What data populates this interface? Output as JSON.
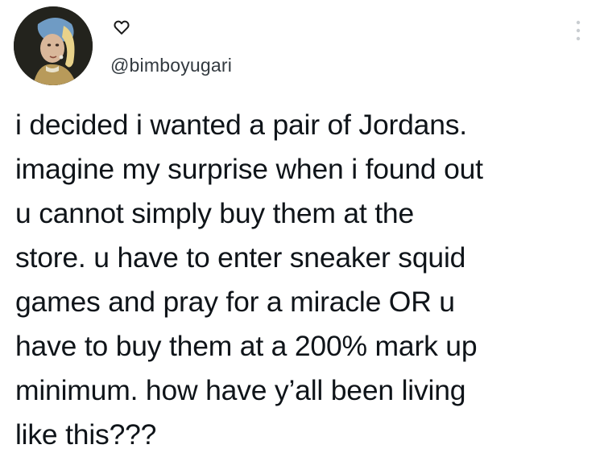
{
  "tweet": {
    "handle": "@bimboyugari",
    "text": "i decided i wanted a pair of Jordans.\nimagine my surprise when i found out\nu cannot simply buy them at the\nstore. u have to enter sneaker squid\ngames and pray for a miracle OR u\nhave to buy them at a 200% mark up\nminimum. how have y’all been living\nlike this???"
  },
  "icons": {
    "name_badge": "heart-outline-icon",
    "menu": "more-options-icon"
  }
}
